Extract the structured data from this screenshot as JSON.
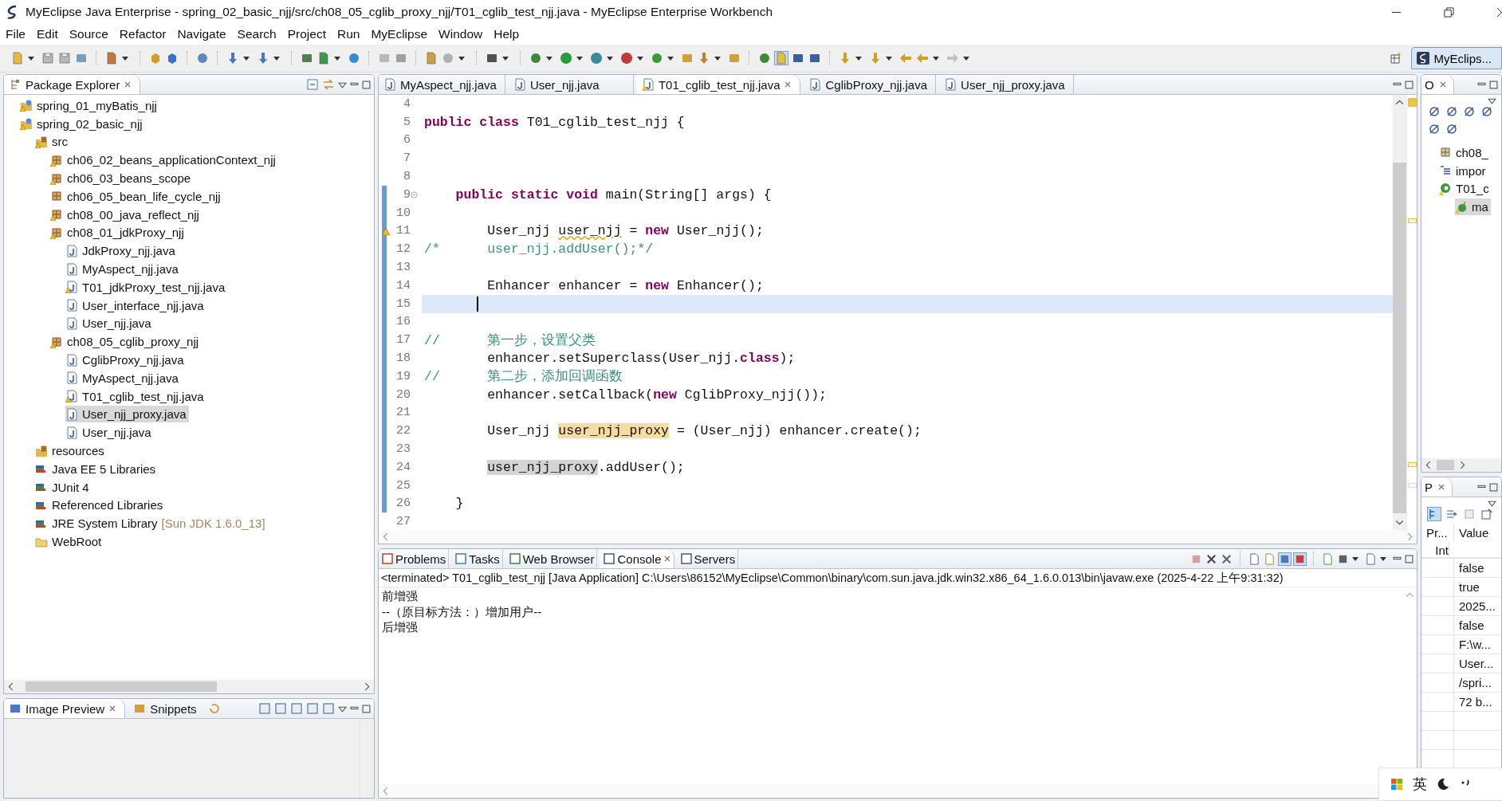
{
  "window": {
    "title": "MyEclipse Java Enterprise - spring_02_basic_njj/src/ch08_05_cglib_proxy_njj/T01_cglib_test_njj.java - MyEclipse Enterprise Workbench",
    "tray": {
      "ime": "英"
    }
  },
  "menu": [
    "File",
    "Edit",
    "Source",
    "Refactor",
    "Navigate",
    "Search",
    "Project",
    "Run",
    "MyEclipse",
    "Window",
    "Help"
  ],
  "perspective": {
    "label": "MyEclips...",
    "selected": true
  },
  "package_explorer": {
    "title": "Package Explorer",
    "tree": [
      {
        "label": "spring_01_myBatis_njj",
        "kind": "project",
        "warning": true,
        "selected": false
      },
      {
        "label": "spring_02_basic_njj",
        "kind": "project",
        "warning": true,
        "selected": false,
        "children": [
          {
            "label": "src",
            "kind": "source-folder",
            "warning": true,
            "selected": false,
            "children": [
              {
                "label": "ch06_02_beans_applicationContext_njj",
                "kind": "package",
                "warning": true,
                "selected": false
              },
              {
                "label": "ch06_03_beans_scope",
                "kind": "package",
                "warning": true,
                "selected": false
              },
              {
                "label": "ch06_05_bean_life_cycle_njj",
                "kind": "package",
                "warning": false,
                "selected": false
              },
              {
                "label": "ch08_00_java_reflect_njj",
                "kind": "package",
                "warning": true,
                "selected": false
              },
              {
                "label": "ch08_01_jdkProxy_njj",
                "kind": "package",
                "warning": true,
                "selected": false,
                "children": [
                  {
                    "label": "JdkProxy_njj.java",
                    "kind": "java",
                    "warning": false,
                    "selected": false
                  },
                  {
                    "label": "MyAspect_njj.java",
                    "kind": "java",
                    "warning": false,
                    "selected": false
                  },
                  {
                    "label": "T01_jdkProxy_test_njj.java",
                    "kind": "java",
                    "warning": true,
                    "selected": false
                  },
                  {
                    "label": "User_interface_njj.java",
                    "kind": "java",
                    "warning": false,
                    "selected": false
                  },
                  {
                    "label": "User_njj.java",
                    "kind": "java",
                    "warning": false,
                    "selected": false
                  }
                ]
              },
              {
                "label": "ch08_05_cglib_proxy_njj",
                "kind": "package",
                "warning": true,
                "selected": false,
                "children": [
                  {
                    "label": "CglibProxy_njj.java",
                    "kind": "java",
                    "warning": false,
                    "selected": false
                  },
                  {
                    "label": "MyAspect_njj.java",
                    "kind": "java",
                    "warning": false,
                    "selected": false
                  },
                  {
                    "label": "T01_cglib_test_njj.java",
                    "kind": "java",
                    "warning": true,
                    "selected": false
                  },
                  {
                    "label": "User_njj_proxy.java",
                    "kind": "java",
                    "warning": false,
                    "selected": true
                  },
                  {
                    "label": "User_njj.java",
                    "kind": "java",
                    "warning": false,
                    "selected": false
                  }
                ]
              }
            ]
          },
          {
            "label": "resources",
            "kind": "source-folder",
            "warning": false,
            "selected": false
          },
          {
            "label": "Java EE 5 Libraries",
            "kind": "library",
            "warning": false,
            "selected": false
          },
          {
            "label": "JUnit 4",
            "kind": "library",
            "warning": false,
            "selected": false
          },
          {
            "label": "Referenced Libraries",
            "kind": "library",
            "warning": false,
            "selected": false
          },
          {
            "label": "JRE System Library",
            "detail": "[Sun JDK 1.6.0_13]",
            "kind": "library",
            "warning": false,
            "selected": false
          },
          {
            "label": "WebRoot",
            "kind": "folder",
            "warning": false,
            "selected": false
          }
        ]
      }
    ]
  },
  "image_preview": {
    "tabs": [
      {
        "label": "Image Preview",
        "selected": true
      },
      {
        "label": "Snippets",
        "selected": false
      }
    ]
  },
  "editor": {
    "tabs": [
      {
        "label": "MyAspect_njj.java",
        "selected": false,
        "warning": false
      },
      {
        "label": "User_njj.java",
        "selected": false,
        "warning": false
      },
      {
        "label": "T01_cglib_test_njj.java",
        "selected": true,
        "warning": true
      },
      {
        "label": "CglibProxy_njj.java",
        "selected": false,
        "warning": false
      },
      {
        "label": "User_njj_proxy.java",
        "selected": false,
        "warning": false
      }
    ],
    "lines": [
      {
        "number": "4",
        "range": false,
        "current": false,
        "warning": false,
        "foldable": false
      },
      {
        "number": "5",
        "range": false,
        "current": false,
        "warning": false,
        "foldable": false,
        "tokens": [
          {
            "kind": "keyword",
            "text": "public "
          },
          {
            "kind": "keyword",
            "text": "class "
          },
          {
            "kind": "plain",
            "text": "T01_cglib_test_njj {"
          }
        ]
      },
      {
        "number": "6",
        "range": false,
        "current": false,
        "warning": false,
        "foldable": false
      },
      {
        "number": "7",
        "range": false,
        "current": false,
        "warning": false,
        "foldable": false
      },
      {
        "number": "8",
        "range": false,
        "current": false,
        "warning": false,
        "foldable": false
      },
      {
        "number": "9",
        "range": true,
        "current": false,
        "warning": false,
        "foldable": true,
        "tokens": [
          {
            "kind": "keyword",
            "text": "    public "
          },
          {
            "kind": "keyword",
            "text": "static "
          },
          {
            "kind": "keyword",
            "text": "void "
          },
          {
            "kind": "plain",
            "text": "main(String[] args) {"
          }
        ]
      },
      {
        "number": "10",
        "range": true,
        "current": false,
        "warning": false,
        "foldable": false
      },
      {
        "number": "11",
        "range": true,
        "current": false,
        "warning": true,
        "foldable": false,
        "tokens": [
          {
            "kind": "plain",
            "text": "        User_njj "
          },
          {
            "kind": "warning",
            "text": "user_njj"
          },
          {
            "kind": "plain",
            "text": " = "
          },
          {
            "kind": "keyword",
            "text": "new"
          },
          {
            "kind": "plain",
            "text": " User_njj();"
          }
        ]
      },
      {
        "number": "12",
        "range": true,
        "current": false,
        "warning": false,
        "foldable": false,
        "tokens": [
          {
            "kind": "comment",
            "text": "/*      user_njj.addUser();*/"
          }
        ]
      },
      {
        "number": "13",
        "range": true,
        "current": false,
        "warning": false,
        "foldable": false
      },
      {
        "number": "14",
        "range": true,
        "current": false,
        "warning": false,
        "foldable": false,
        "tokens": [
          {
            "kind": "plain",
            "text": "        Enhancer enhancer = "
          },
          {
            "kind": "keyword",
            "text": "new"
          },
          {
            "kind": "plain",
            "text": " Enhancer();"
          }
        ]
      },
      {
        "number": "15",
        "range": true,
        "current": true,
        "warning": false,
        "foldable": false
      },
      {
        "number": "16",
        "range": true,
        "current": false,
        "warning": false,
        "foldable": false
      },
      {
        "number": "17",
        "range": true,
        "current": false,
        "warning": false,
        "foldable": false,
        "tokens": [
          {
            "kind": "comment",
            "text": "//      第一步，设置父类"
          }
        ]
      },
      {
        "number": "18",
        "range": true,
        "current": false,
        "warning": false,
        "foldable": false,
        "tokens": [
          {
            "kind": "plain",
            "text": "        enhancer.setSuperclass(User_njj."
          },
          {
            "kind": "keyword",
            "text": "class"
          },
          {
            "kind": "plain",
            "text": ");"
          }
        ]
      },
      {
        "number": "19",
        "range": true,
        "current": false,
        "warning": false,
        "foldable": false,
        "tokens": [
          {
            "kind": "comment",
            "text": "//      第二步，添加回调函数"
          }
        ]
      },
      {
        "number": "20",
        "range": true,
        "current": false,
        "warning": false,
        "foldable": false,
        "tokens": [
          {
            "kind": "plain",
            "text": "        enhancer.setCallback("
          },
          {
            "kind": "keyword",
            "text": "new"
          },
          {
            "kind": "plain",
            "text": " CglibProxy_njj());"
          }
        ]
      },
      {
        "number": "21",
        "range": true,
        "current": false,
        "warning": false,
        "foldable": false
      },
      {
        "number": "22",
        "range": true,
        "current": false,
        "warning": false,
        "foldable": false,
        "tokens": [
          {
            "kind": "plain",
            "text": "        User_njj "
          },
          {
            "kind": "write",
            "text": "user_njj_proxy"
          },
          {
            "kind": "plain",
            "text": " = (User_njj) enhancer.create();"
          }
        ]
      },
      {
        "number": "23",
        "range": true,
        "current": false,
        "warning": false,
        "foldable": false
      },
      {
        "number": "24",
        "range": true,
        "current": false,
        "warning": false,
        "foldable": false,
        "tokens": [
          {
            "kind": "read",
            "text": "        user_njj_proxy"
          },
          {
            "kind": "plain",
            "text": ".addUser();"
          }
        ]
      },
      {
        "number": "25",
        "range": true,
        "current": false,
        "warning": false,
        "foldable": false
      },
      {
        "number": "26",
        "range": true,
        "current": false,
        "warning": false,
        "foldable": false,
        "tokens": [
          {
            "kind": "plain",
            "text": "    }"
          }
        ]
      },
      {
        "number": "27",
        "range": false,
        "current": false,
        "warning": false,
        "foldable": false
      }
    ]
  },
  "console": {
    "tabs": [
      {
        "label": "Problems",
        "selected": false
      },
      {
        "label": "Tasks",
        "selected": false
      },
      {
        "label": "Web Browser",
        "selected": false
      },
      {
        "label": "Console",
        "selected": true
      },
      {
        "label": "Servers",
        "selected": false
      }
    ],
    "status": "<terminated> T01_cglib_test_njj [Java Application] C:\\Users\\86152\\MyEclipse\\Common\\binary\\com.sun.java.jdk.win32.x86_64_1.6.0.013\\bin\\javaw.exe (2025-4-22 上午9:31:32)",
    "output": [
      "前增强",
      "--（原目标方法：）增加用户--",
      "后增强"
    ]
  },
  "outline": {
    "title": "O",
    "tree": [
      {
        "label": "ch08_",
        "kind": "package",
        "selected": false
      },
      {
        "label": "impor",
        "kind": "imports",
        "selected": false
      },
      {
        "label": "T01_c",
        "kind": "class",
        "selected": false,
        "children": [
          {
            "label": "ma",
            "kind": "method",
            "selected": true
          }
        ]
      }
    ]
  },
  "properties": {
    "title": "P",
    "columns": [
      "Pr...",
      "Value"
    ],
    "category": "Int",
    "values": [
      "false",
      "true",
      "2025...",
      "false",
      "F:\\w...",
      "User...",
      "/spri...",
      "72  b..."
    ]
  }
}
